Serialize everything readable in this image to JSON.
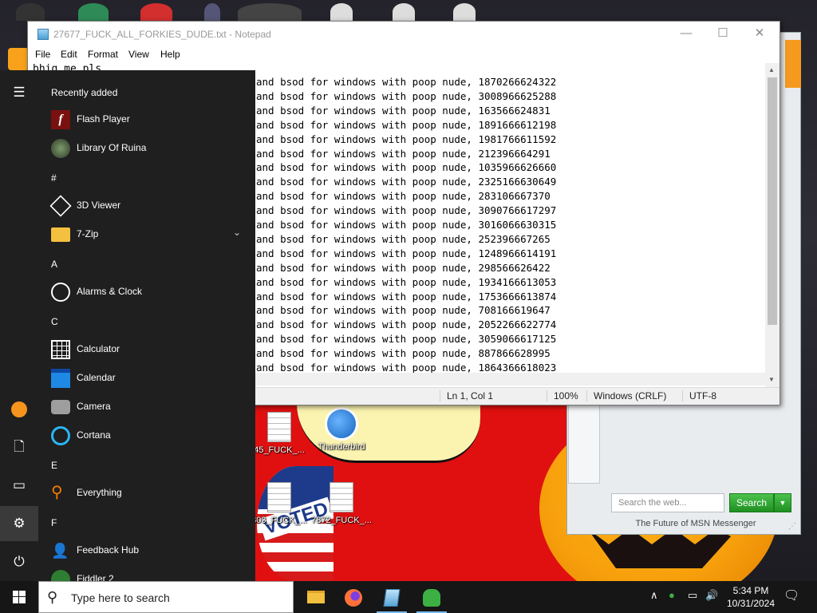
{
  "notepad": {
    "title": "27677_FUCK_ALL_FORKIES_DUDE.txt - Notepad",
    "menu": [
      "File",
      "Edit",
      "Format",
      "View",
      "Help"
    ],
    "first_line": "bhig me pls",
    "lines": [
      "and bsod for windows with poop nude, 1870266624322",
      "and bsod for windows with poop nude, 3008966625288",
      "and bsod for windows with poop nude, 163566624831",
      "and bsod for windows with poop nude, 1891666612198",
      "and bsod for windows with poop nude, 1981766611592",
      "and bsod for windows with poop nude, 212396664291",
      "and bsod for windows with poop nude, 1035966626660",
      "and bsod for windows with poop nude, 2325166630649",
      "and bsod for windows with poop nude, 283106667370",
      "and bsod for windows with poop nude, 3090766617297",
      "and bsod for windows with poop nude, 3016066630315",
      "and bsod for windows with poop nude, 252396667265",
      "and bsod for windows with poop nude, 1248966614191",
      "and bsod for windows with poop nude, 298566626422",
      "and bsod for windows with poop nude, 1934166613053",
      "and bsod for windows with poop nude, 1753666613874",
      "and bsod for windows with poop nude, 708166619647",
      "and bsod for windows with poop nude, 2052266622774",
      "and bsod for windows with poop nude, 3059066617125",
      "and bsod for windows with poop nude, 887866628995",
      "and bsod for windows with poop nude, 1864366618023"
    ],
    "status": {
      "position": "Ln 1, Col 1",
      "zoom": "100%",
      "line_ending": "Windows (CRLF)",
      "encoding": "UTF-8"
    }
  },
  "start_menu": {
    "recently_added_label": "Recently added",
    "recent": [
      {
        "label": "Flash Player",
        "icon": "flash-player-icon"
      },
      {
        "label": "Library Of Ruina",
        "icon": "library-of-ruina-icon"
      }
    ],
    "sections": [
      {
        "header": "#",
        "apps": [
          {
            "label": "3D Viewer",
            "icon": "3d-viewer-icon"
          },
          {
            "label": "7-Zip",
            "icon": "folder-icon",
            "expandable": true
          }
        ]
      },
      {
        "header": "A",
        "apps": [
          {
            "label": "Alarms & Clock",
            "icon": "alarm-clock-icon"
          }
        ]
      },
      {
        "header": "C",
        "apps": [
          {
            "label": "Calculator",
            "icon": "calculator-icon"
          },
          {
            "label": "Calendar",
            "icon": "calendar-icon"
          },
          {
            "label": "Camera",
            "icon": "camera-icon"
          },
          {
            "label": "Cortana",
            "icon": "cortana-icon"
          }
        ]
      },
      {
        "header": "E",
        "apps": [
          {
            "label": "Everything",
            "icon": "everything-search-icon"
          }
        ]
      },
      {
        "header": "F",
        "apps": [
          {
            "label": "Feedback Hub",
            "icon": "feedback-hub-icon"
          },
          {
            "label": "Fiddler 2",
            "icon": "fiddler-icon"
          }
        ]
      }
    ]
  },
  "desktop": {
    "icons": [
      {
        "label": "45_FUCK_...",
        "type": "text-file"
      },
      {
        "label": "Thunderbird",
        "type": "thunderbird"
      },
      {
        "label": "803_FUCK_...",
        "type": "text-file"
      },
      {
        "label": "7872_FUCK_...",
        "type": "text-file"
      }
    ],
    "voted_sticker": "VOTED"
  },
  "msn": {
    "search_placeholder": "Search the web...",
    "search_button": "Search",
    "footer": "The Future of MSN Messenger"
  },
  "taskbar": {
    "search_placeholder": "Type here to search",
    "apps": [
      "file-explorer-icon",
      "firefox-icon",
      "notepad-icon",
      "msn-messenger-icon"
    ],
    "time": "5:34 PM",
    "date": "10/31/2024"
  },
  "colors": {
    "start_bg": "#1f1f1f",
    "taskbar_bg": "#161616",
    "accent": "#0078d7",
    "msn_green": "#2ba52f"
  }
}
